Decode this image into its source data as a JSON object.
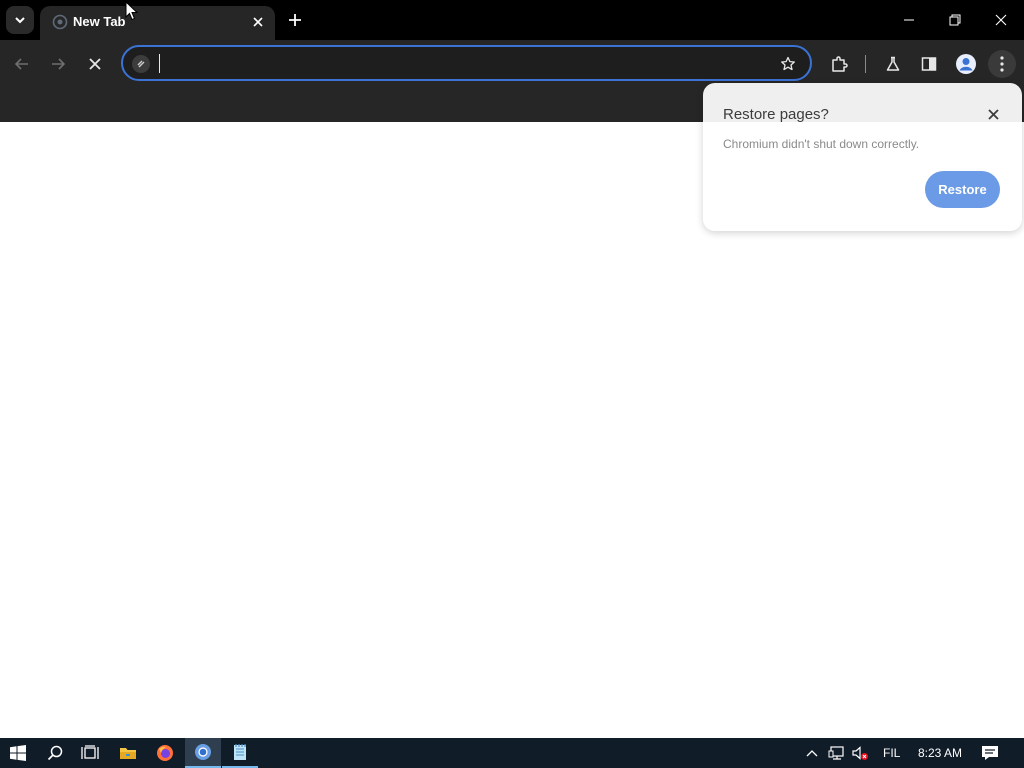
{
  "browser": {
    "tab": {
      "title": "New Tab"
    },
    "omnibox": {
      "value": "",
      "placeholder": ""
    }
  },
  "restore_bubble": {
    "title": "Restore pages?",
    "message": "Chromium didn't shut down correctly.",
    "restore_label": "Restore"
  },
  "taskbar": {
    "apps": [
      "start-icon",
      "search-icon",
      "task-view-icon",
      "file-explorer-icon",
      "firefox-icon",
      "chromium-icon",
      "notepad-icon"
    ],
    "language": "FIL",
    "time": "8:23 AM"
  },
  "colors": {
    "accent": "#3b73d4",
    "restore_button": "#6b9be6",
    "toolbar": "#262626",
    "taskbar": "#101c28"
  }
}
